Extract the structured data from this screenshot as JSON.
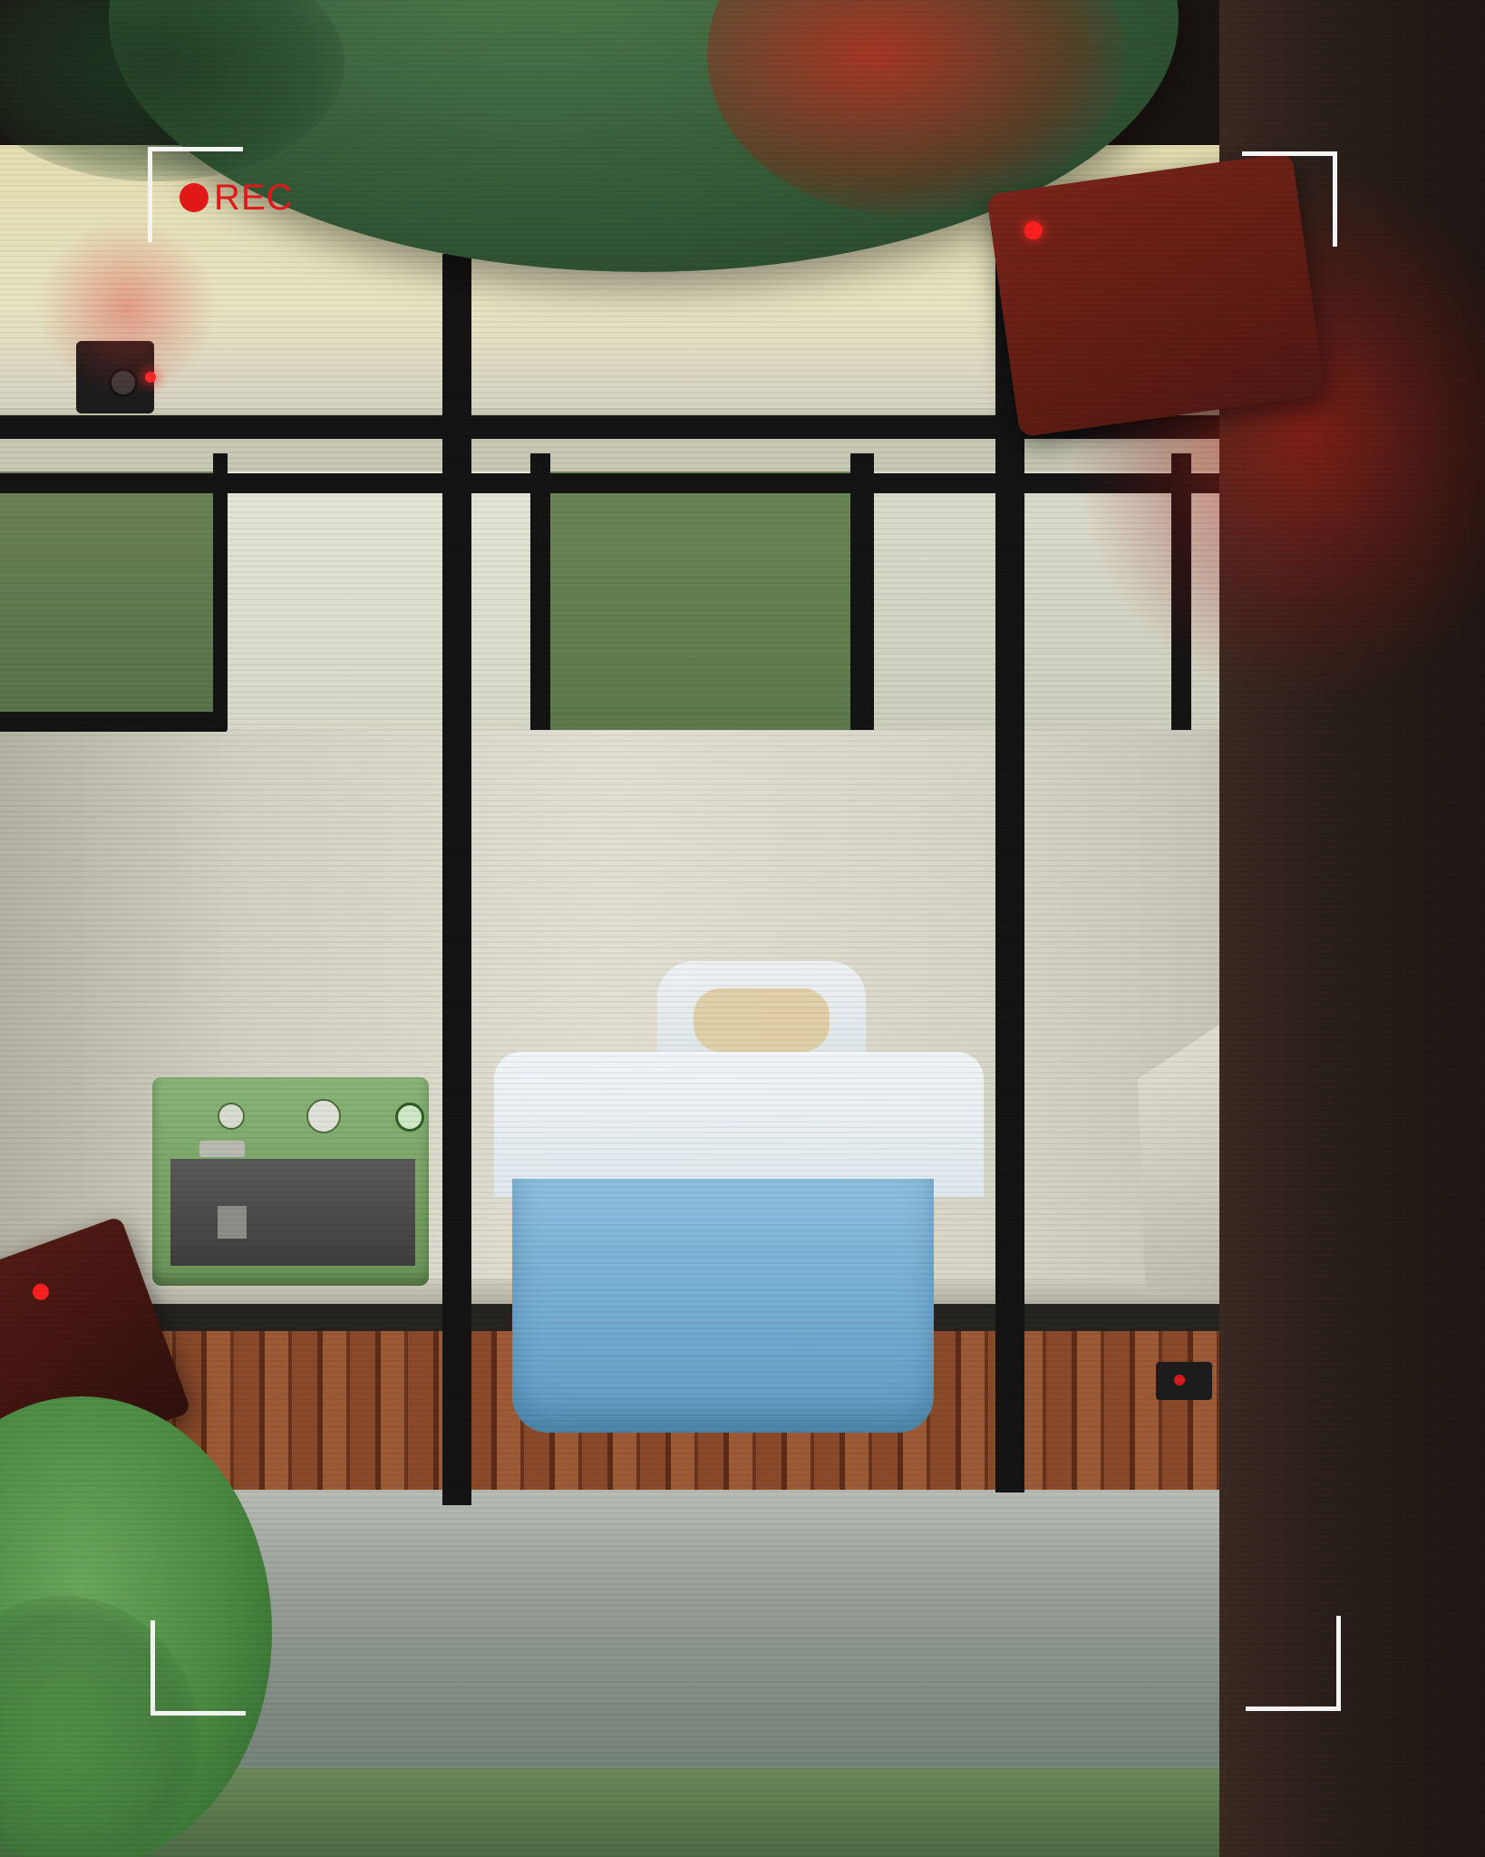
{
  "hud": {
    "rec_label": "REC",
    "rec_color": "#e01818"
  },
  "icons": {
    "rec_dot": "record-dot-icon",
    "camera": "security-camera-icon"
  },
  "colors": {
    "wall": "#d8d4c2",
    "cabinet_green": "#5c7a4c",
    "counter_wood": "#8a4a2a",
    "floor": "#8c958e",
    "espresso_green": "#7fa86a",
    "water_jug": "#7cb4d8",
    "grate": "#151515",
    "vignette_red": "#b01c14",
    "side_panel": "#2a1f1a"
  }
}
